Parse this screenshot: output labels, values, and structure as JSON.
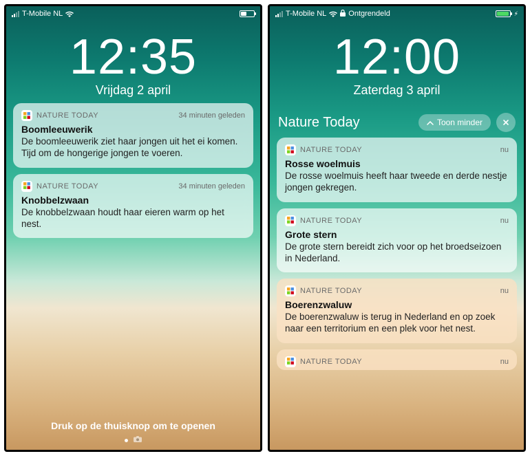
{
  "left": {
    "statusbar": {
      "carrier": "T-Mobile NL",
      "locked_label": ""
    },
    "clock": {
      "time": "12:35",
      "date": "Vrijdag 2 april"
    },
    "app_name": "NATURE TODAY",
    "notifications": [
      {
        "time": "34 minuten geleden",
        "title": "Boomleeuwerik",
        "body": "De boomleeuwerik ziet haar jongen uit het ei komen. Tijd om de hongerige jongen te voeren."
      },
      {
        "time": "34 minuten geleden",
        "title": "Knobbelzwaan",
        "body": "De knobbelzwaan houdt haar eieren warm op het nest."
      }
    ],
    "unlock_hint": "Druk op de thuisknop om te openen"
  },
  "right": {
    "statusbar": {
      "carrier": "T-Mobile NL",
      "locked_label": "Ontgrendeld"
    },
    "clock": {
      "time": "12:00",
      "date": "Zaterdag 3 april"
    },
    "group": {
      "title": "Nature Today",
      "show_less": "Toon minder"
    },
    "app_name": "NATURE TODAY",
    "notifications": [
      {
        "time": "nu",
        "title": "Rosse woelmuis",
        "body": "De rosse woelmuis heeft haar tweede en derde nestje jongen gekregen."
      },
      {
        "time": "nu",
        "title": "Grote stern",
        "body": "De grote stern bereidt zich voor op het broedseizoen in Nederland."
      },
      {
        "time": "nu",
        "title": "Boerenzwaluw",
        "body": "De boerenzwaluw is terug in Nederland en op zoek naar een territorium en een plek voor het nest."
      },
      {
        "time": "nu",
        "title": "",
        "body": ""
      }
    ]
  }
}
